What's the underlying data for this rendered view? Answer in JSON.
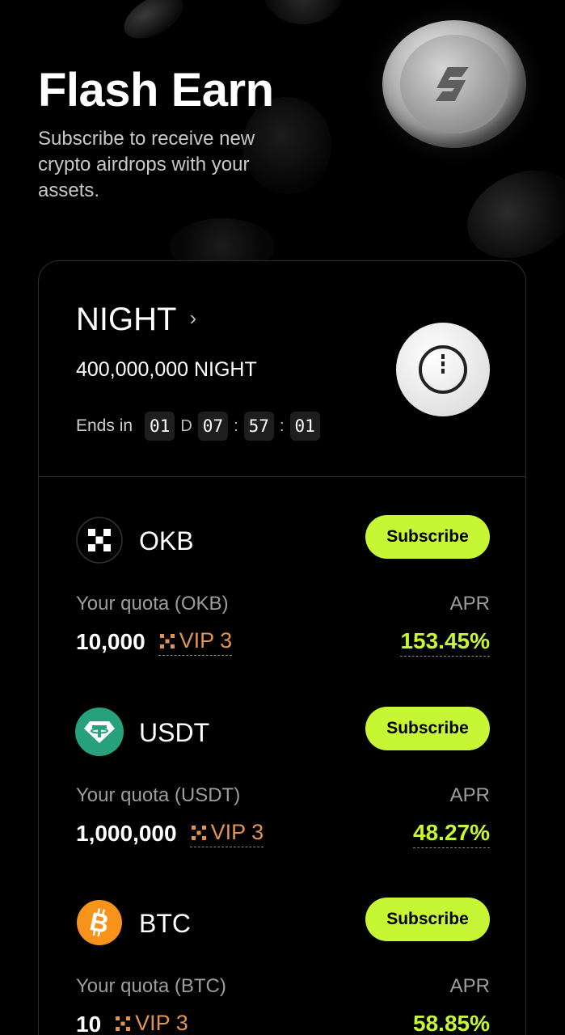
{
  "header": {
    "title": "Flash Earn",
    "subtitle": "Subscribe to receive new crypto airdrops with your assets."
  },
  "project": {
    "name": "NIGHT",
    "amount": "400,000,000 NIGHT",
    "ends_label": "Ends in",
    "countdown": {
      "days": "01",
      "day_unit": "D",
      "hours": "07",
      "minutes": "57",
      "seconds": "01"
    }
  },
  "assets": [
    {
      "name": "OKB",
      "button": "Subscribe",
      "quota_label": "Your quota (OKB)",
      "quota": "10,000",
      "vip": "VIP 3",
      "apr_label": "APR",
      "apr": "153.45%",
      "icon": "okb-icon",
      "color": "#000000"
    },
    {
      "name": "USDT",
      "button": "Subscribe",
      "quota_label": "Your quota (USDT)",
      "quota": "1,000,000",
      "vip": "VIP 3",
      "apr_label": "APR",
      "apr": "48.27%",
      "icon": "usdt-icon",
      "color": "#26a17b"
    },
    {
      "name": "BTC",
      "button": "Subscribe",
      "quota_label": "Your quota (BTC)",
      "quota": "10",
      "vip": "VIP 3",
      "apr_label": "APR",
      "apr": "58.85%",
      "icon": "btc-icon",
      "color": "#f7931a"
    }
  ],
  "colors": {
    "accent": "#c6f634",
    "vip": "#e09450",
    "background": "#000000"
  }
}
